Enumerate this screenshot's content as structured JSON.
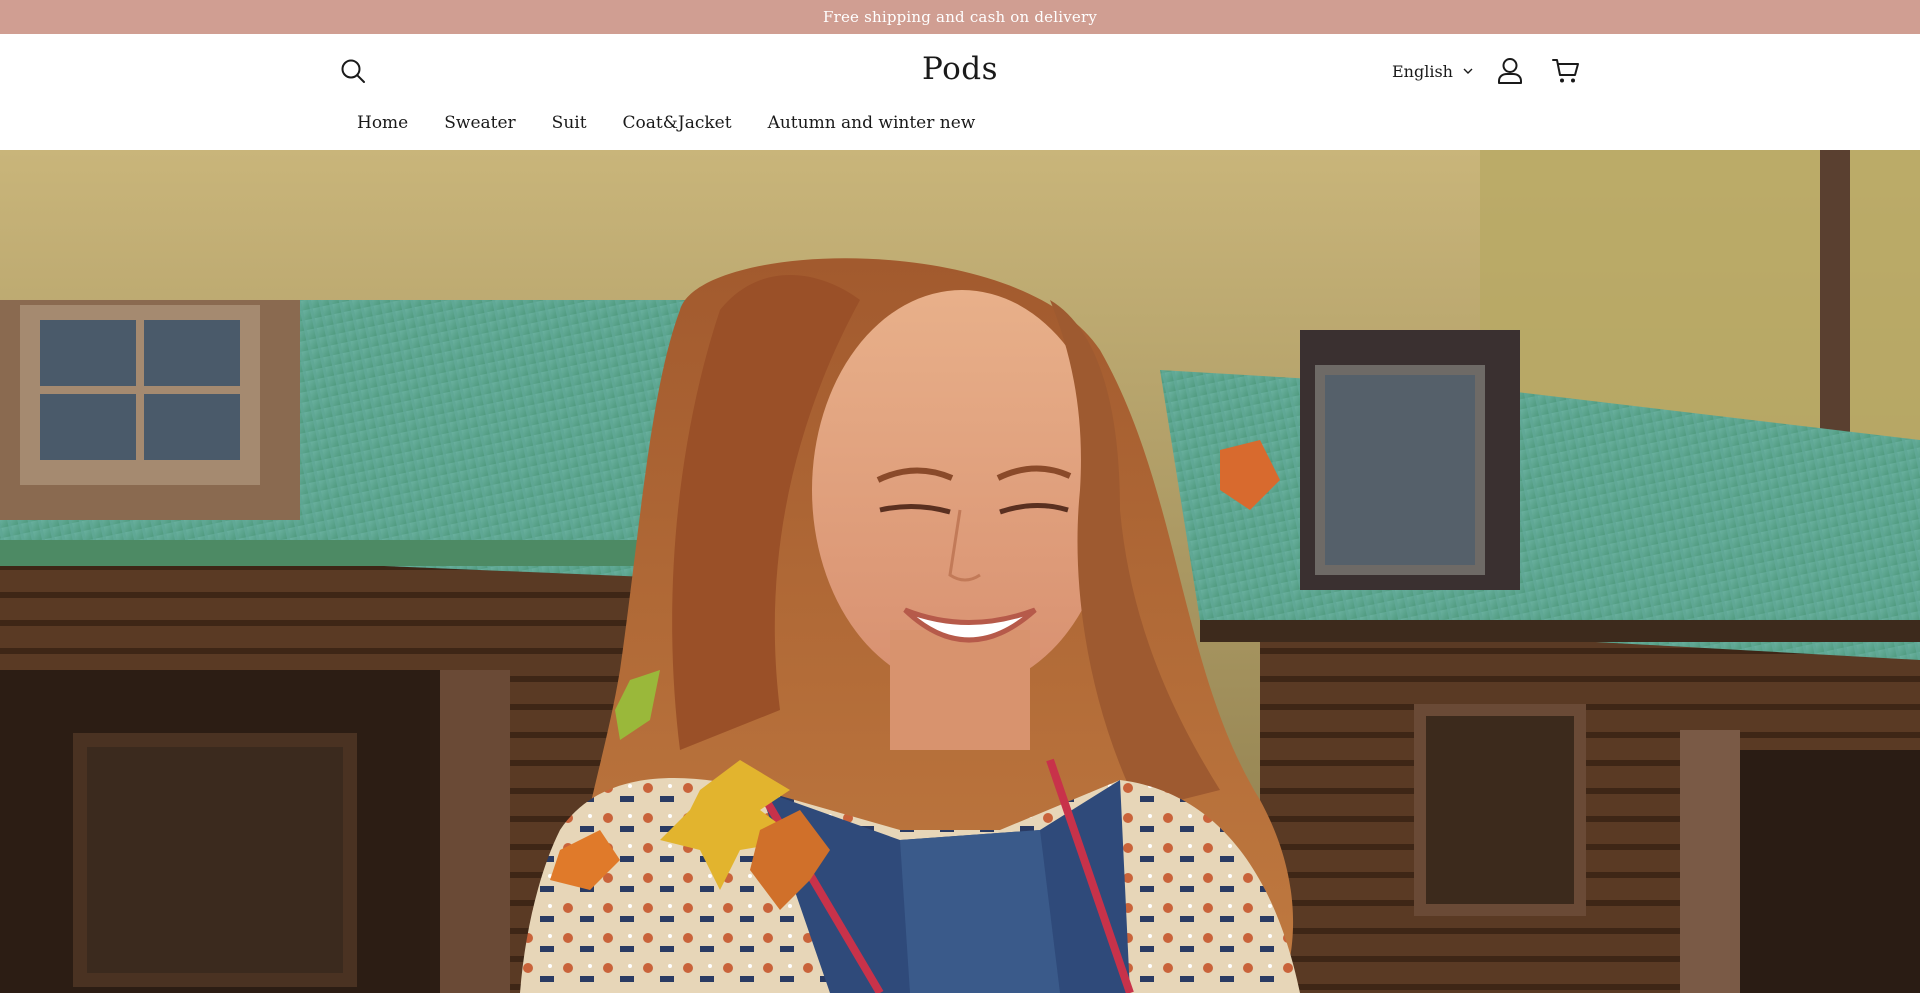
{
  "announcement": {
    "text": "Free shipping and cash on delivery",
    "background": "#d09e92",
    "color": "#ffffff"
  },
  "header": {
    "logo": "Pods",
    "language": "English",
    "icons": {
      "search": "search-icon",
      "account": "user-icon",
      "cart": "cart-icon",
      "language_caret": "chevron-down-icon"
    }
  },
  "nav": {
    "items": [
      {
        "label": "Home"
      },
      {
        "label": "Sweater"
      },
      {
        "label": "Suit"
      },
      {
        "label": "Coat&Jacket"
      },
      {
        "label": "Autumn and winter new"
      }
    ]
  },
  "hero": {
    "image_label": "hero-banner-image"
  },
  "colors": {
    "announcement_bg": "#d09e92",
    "text": "#1a1a1a",
    "background": "#ffffff"
  }
}
